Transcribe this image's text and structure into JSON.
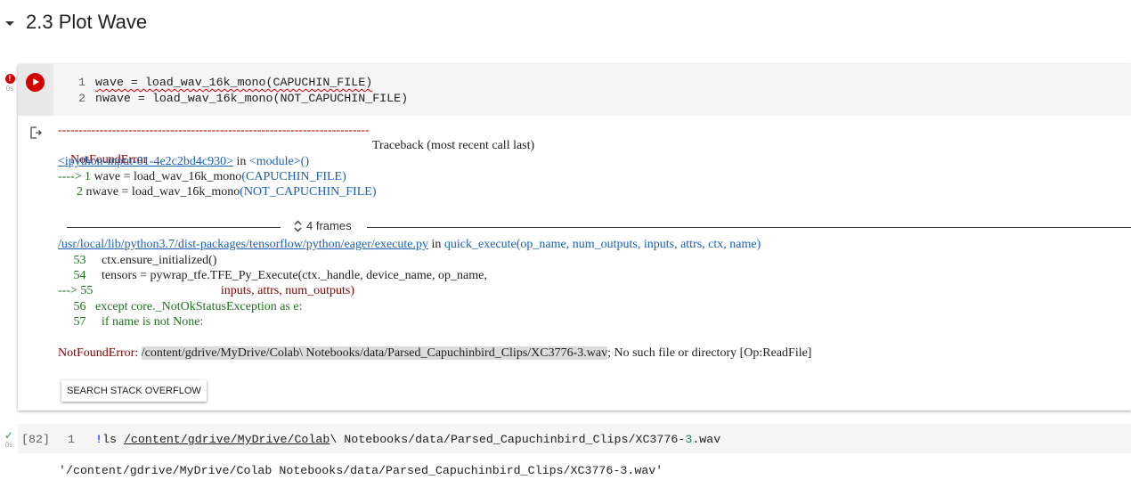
{
  "section": {
    "title": "2.3 Plot Wave",
    "caret_icon": "caret-down-icon"
  },
  "cell1": {
    "status_icon": "error-icon",
    "status_glyph": "!",
    "exec_time": "0s",
    "run_icon": "play-icon",
    "lines": [
      {
        "num": "1",
        "code": "wave = load_wav_16k_mono(CAPUCHIN_FILE)"
      },
      {
        "num": "2",
        "code": "nwave = load_wav_16k_mono(NOT_CAPUCHIN_FILE)"
      }
    ],
    "output": {
      "icon": "output-arrow-icon",
      "dashes": "---------------------------------------------------------------------------",
      "error_name": "NotFoundError",
      "traceback_label": "Traceback (most recent call last)",
      "input_link": "<ipython-input-81-4e2c2bd4c930>",
      "in_word": " in ",
      "module_text": "<module>()",
      "frame1": [
        {
          "arrow": "----> ",
          "num": "1",
          "code": " wave = load_wav_16k_mono",
          "args": "(CAPUCHIN_FILE)"
        },
        {
          "arrow": "      ",
          "num": "2",
          "code": " nwave = load_wav_16k_mono",
          "args": "(NOT_CAPUCHIN_FILE)"
        }
      ],
      "frames_toggle": "4 frames",
      "file_link": "/usr/local/lib/python3.7/dist-packages/tensorflow/python/eager/execute.py",
      "func_sig": "quick_execute(op_name, num_outputs, inputs, attrs, ctx, name)",
      "frame2": [
        {
          "prefix": "     53",
          "code": "     ctx.ensure_initialized()"
        },
        {
          "prefix": "     54",
          "code": "     tensors = pywrap_tfe.TFE_Py_Execute(ctx._handle, device_name, op_name,"
        },
        {
          "prefix": "---> 55",
          "code": "                                         inputs, attrs, num_outputs)"
        },
        {
          "prefix": "     56",
          "code": "   except core._NotOkStatusException as e:"
        },
        {
          "prefix": "     57",
          "code": "     if name is not None:"
        }
      ],
      "final_error_name": "NotFoundError:",
      "final_error_path": "/content/gdrive/MyDrive/Colab\\ Notebooks/data/Parsed_Capuchinbird_Clips/XC3776-3.wav",
      "final_error_rest": "; No such file or directory [Op:ReadFile]"
    },
    "search_button": "SEARCH STACK OVERFLOW"
  },
  "cell2": {
    "status_icon": "check-icon",
    "exec_time": "0s",
    "exec_count": "[82]",
    "line_num": "1",
    "bang": "!",
    "cmd": "ls ",
    "path_underlined": "/content/gdrive/MyDrive/Colab",
    "path_rest_a": "\\ Notebooks/data/Parsed_Capuchinbird_Clips/XC3776-",
    "path_num": "3",
    "path_rest_b": ".wav",
    "output": "'/content/gdrive/MyDrive/Colab Notebooks/data/Parsed_Capuchinbird_Clips/XC3776-3.wav'"
  }
}
